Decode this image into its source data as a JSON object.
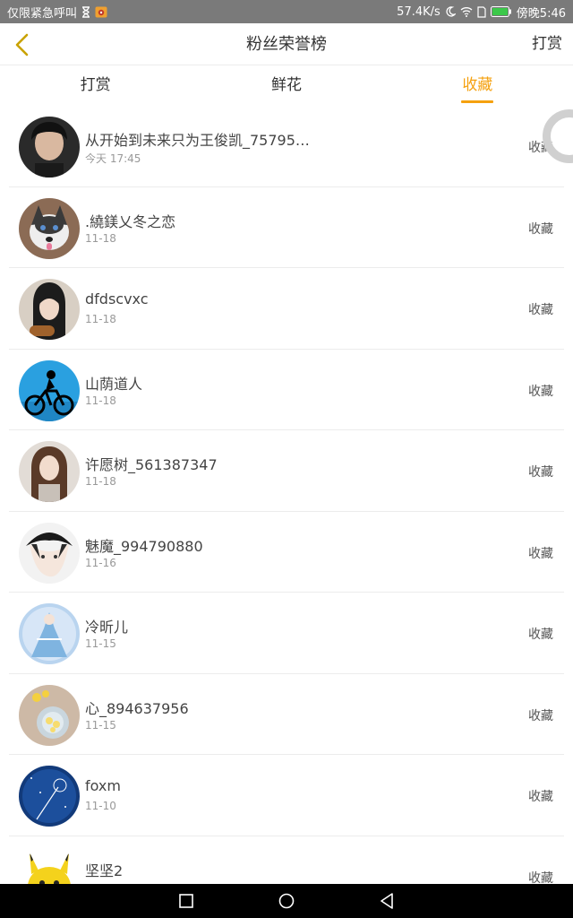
{
  "status_bar": {
    "left_text": "仅限紧急呼叫",
    "speed": "57.4K/s",
    "time": "傍晚5:46"
  },
  "header": {
    "title": "粉丝荣誉榜",
    "right_action": "打赏"
  },
  "tabs": [
    {
      "label": "打赏",
      "active": false
    },
    {
      "label": "鲜花",
      "active": false
    },
    {
      "label": "收藏",
      "active": true
    }
  ],
  "colors": {
    "accent": "#f5a10f",
    "status_bar": "#7a7a7a"
  },
  "list": [
    {
      "name": "从开始到未来只为王俊凯_75795…",
      "time": "今天 17:45",
      "action": "收藏"
    },
    {
      "name": ".繞鎂乂冬之恋",
      "time": "11-18",
      "action": "收藏"
    },
    {
      "name": "dfdscvxc",
      "time": "11-18",
      "action": "收藏"
    },
    {
      "name": "山荫道人",
      "time": "11-18",
      "action": "收藏"
    },
    {
      "name": "许愿树_561387347",
      "time": "11-18",
      "action": "收藏"
    },
    {
      "name": "魅魔_994790880",
      "time": "11-16",
      "action": "收藏"
    },
    {
      "name": "冷昕儿",
      "time": "11-15",
      "action": "收藏"
    },
    {
      "name": "心_894637956",
      "time": "11-15",
      "action": "收藏"
    },
    {
      "name": "foxm",
      "time": "11-10",
      "action": "收藏"
    },
    {
      "name": "坚坚2",
      "time": "",
      "action": "收藏"
    }
  ]
}
